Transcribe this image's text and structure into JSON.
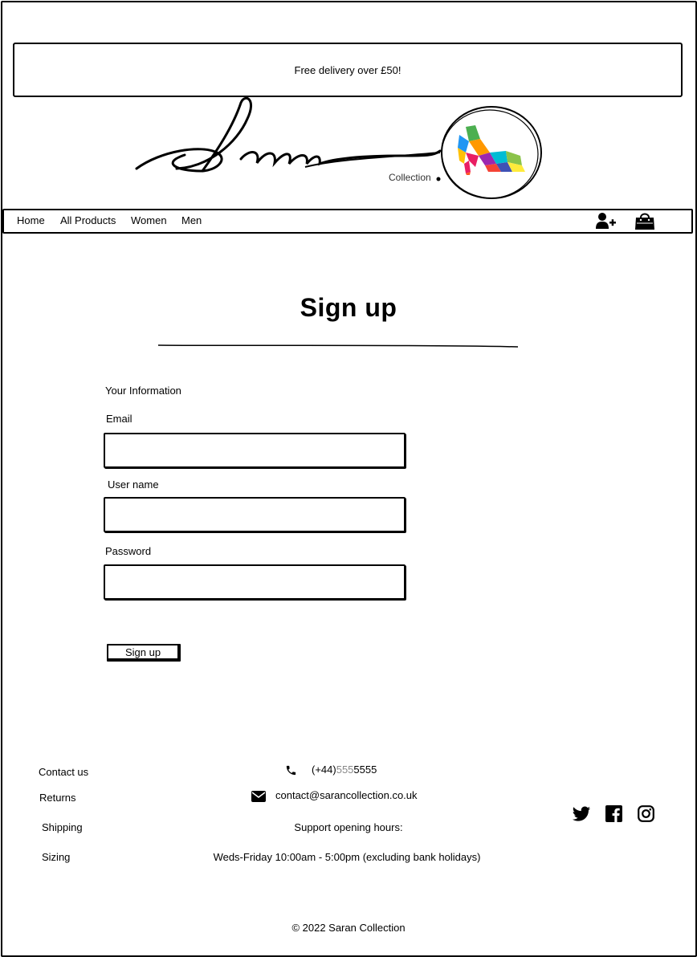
{
  "banner": {
    "text": "Free delivery over £50!"
  },
  "logo": {
    "script_text": "Saran",
    "subtitle": "Collection"
  },
  "nav": {
    "links": [
      "Home",
      "All Products",
      "Women",
      "Men"
    ],
    "icons": [
      "add-user-icon",
      "shopping-bag-icon"
    ]
  },
  "page": {
    "title": "Sign up"
  },
  "form": {
    "section_label": "Your Information",
    "email_label": "Email",
    "email_value": "",
    "username_label": "User name",
    "username_value": "",
    "password_label": "Password",
    "password_value": "",
    "submit_label": "Sign up"
  },
  "footer": {
    "links": [
      "Contact us",
      "Returns",
      "Shipping",
      "Sizing"
    ],
    "phone_prefix": "(+44)",
    "phone_mid": "555",
    "phone_suffix": "5555",
    "email": "contact@sarancollection.co.uk",
    "hours_title": "Support opening hours:",
    "hours": "Weds-Friday 10:00am - 5:00pm (excluding bank holidays)",
    "social_icons": [
      "twitter-icon",
      "facebook-icon",
      "instagram-icon"
    ],
    "copyright": "© 2022 Saran Collection"
  }
}
